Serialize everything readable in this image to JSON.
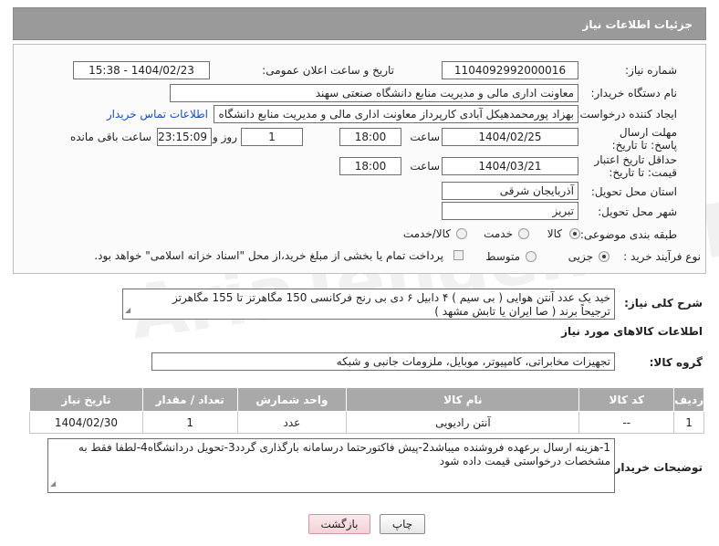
{
  "header": {
    "title": "جزئیات اطلاعات نیاز"
  },
  "form": {
    "need_number_label": "شماره نیاز:",
    "need_number": "1104092992000016",
    "announce_label": "تاریخ و ساعت اعلان عمومی:",
    "announce_value": "1404/02/23 - 15:38",
    "buyer_org_label": "نام دستگاه خریدار:",
    "buyer_org": "معاونت اداری  مالی و مدیریت منابع دانشگاه صنعتی سهند",
    "requester_label": "ایجاد کننده درخواست:",
    "requester": "بهزاد پورمحمدهیکل آبادی کارپرداز معاونت اداری  مالی و مدیریت منابع دانشگاه ص",
    "contact_link": "اطلاعات تماس خریدار",
    "reply_deadline_label": "مهلت ارسال پاسخ: تا تاریخ:",
    "reply_date": "1404/02/25",
    "time_label": "ساعت",
    "reply_time": "18:00",
    "days_value": "1",
    "days_label": "روز و",
    "remaining_time": "23:15:09",
    "remaining_label": "ساعت باقی مانده",
    "validity_label": "حداقل تاریخ اعتبار قیمت: تا تاریخ:",
    "validity_date": "1404/03/21",
    "validity_time": "18:00",
    "province_label": "استان محل تحویل:",
    "province": "آذربایجان شرقی",
    "city_label": "شهر محل تحویل:",
    "city": "تبریز",
    "category_label": "طبقه بندی موضوعی:",
    "category_options": [
      "کالا",
      "خدمت",
      "کالا/خدمت"
    ],
    "process_label": "نوع فرآیند خرید :",
    "process_options": [
      "جزیی",
      "متوسط"
    ],
    "process_note": "پرداخت تمام یا بخشی از مبلغ خرید،از محل \"اسناد خزانه اسلامی\" خواهد بود."
  },
  "description": {
    "label": "شرح کلی نیاز:",
    "line1": "خید یک عدد آنتن هوایی ( بی سیم ) ۴ دابیل ۶ دی بی رنج فرکانسی 150 مگاهرتز تا 155 مگاهرتز",
    "line2": "ترجیحاً برند ( صا ایران یا تابش مشهد )"
  },
  "goods": {
    "section_title": "اطلاعات کالاهای مورد نیاز",
    "group_label": "گروه کالا:",
    "group_value": "تجهیزات مخابراتی، کامپیوتر، موبایل، ملزومات جانبی و شبکه",
    "columns": [
      "ردیف",
      "کد کالا",
      "نام کالا",
      "واحد شمارش",
      "تعداد / مقدار",
      "تاریخ نیاز"
    ],
    "rows": [
      [
        "1",
        "--",
        "آنتن رادیویی",
        "عدد",
        "1",
        "1404/02/30"
      ]
    ]
  },
  "buyer_notes": {
    "label": "توضیحات خریدار:",
    "line1": "1-هزینه ارسال برعهده فروشنده میباشد2-پیش فاکتورحتما درسامانه بارگذاری گردد3-تحویل دردانشگاه4-لطفا فقط به",
    "line2": "مشخصات درخواستی قیمت داده شود"
  },
  "buttons": {
    "print": "چاپ",
    "back": "بازگشت"
  },
  "watermark": "AriaTender.neT"
}
